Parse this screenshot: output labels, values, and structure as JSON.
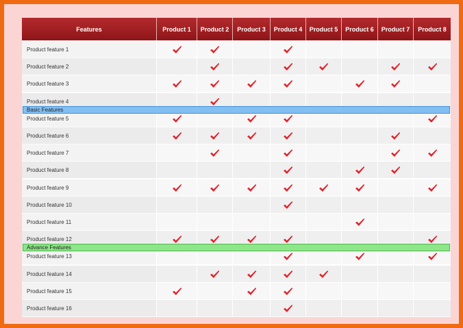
{
  "columns": [
    "Features",
    "Product 1",
    "Product 2",
    "Product 3",
    "Product 4",
    "Product 5",
    "Product 6",
    "Product 7",
    "Product 8"
  ],
  "bands": {
    "basic": "Basic Features",
    "advance": "Advance Features"
  },
  "colors": {
    "outer_border": "#f06a12",
    "frame_bg": "#fbd4d4",
    "header_bg": "#a11f22",
    "check": "#e3202a",
    "basic_band": "#84bff2",
    "advance_band": "#8ee58a"
  },
  "check_icon": "red-checkmark-icon",
  "rows": [
    {
      "label": "Product feature 1",
      "checks": [
        true,
        true,
        false,
        true,
        false,
        false,
        false,
        false
      ]
    },
    {
      "label": "Product feature 2",
      "checks": [
        false,
        true,
        false,
        true,
        true,
        false,
        true,
        true
      ]
    },
    {
      "label": "Product feature 3",
      "checks": [
        true,
        true,
        true,
        true,
        false,
        true,
        true,
        false
      ]
    },
    {
      "label": "Product feature 4",
      "checks": [
        false,
        true,
        false,
        false,
        false,
        false,
        false,
        false
      ]
    },
    {
      "label": "Product feature 5",
      "checks": [
        true,
        false,
        true,
        true,
        false,
        false,
        false,
        true
      ]
    },
    {
      "label": "Product feature 6",
      "checks": [
        true,
        true,
        true,
        true,
        false,
        false,
        true,
        false
      ]
    },
    {
      "label": "Product feature 7",
      "checks": [
        false,
        true,
        false,
        true,
        false,
        false,
        true,
        true
      ]
    },
    {
      "label": "Product feature 8",
      "checks": [
        false,
        false,
        false,
        true,
        false,
        true,
        true,
        false
      ]
    },
    {
      "label": "Product feature 9",
      "checks": [
        true,
        true,
        true,
        true,
        true,
        true,
        false,
        true
      ]
    },
    {
      "label": "Product feature 10",
      "checks": [
        false,
        false,
        false,
        true,
        false,
        false,
        false,
        false
      ]
    },
    {
      "label": "Product feature 11",
      "checks": [
        false,
        false,
        false,
        false,
        false,
        true,
        false,
        false
      ]
    },
    {
      "label": "Product feature 12",
      "checks": [
        true,
        true,
        true,
        true,
        false,
        false,
        false,
        true
      ]
    },
    {
      "label": "Product feature 13",
      "checks": [
        false,
        false,
        false,
        true,
        false,
        true,
        false,
        true
      ]
    },
    {
      "label": "Product feature 14",
      "checks": [
        false,
        true,
        true,
        true,
        true,
        false,
        false,
        false
      ]
    },
    {
      "label": "Product feature 15",
      "checks": [
        true,
        false,
        true,
        true,
        false,
        false,
        false,
        false
      ]
    },
    {
      "label": "Product feature 16",
      "checks": [
        false,
        false,
        false,
        true,
        false,
        false,
        false,
        false
      ]
    }
  ]
}
